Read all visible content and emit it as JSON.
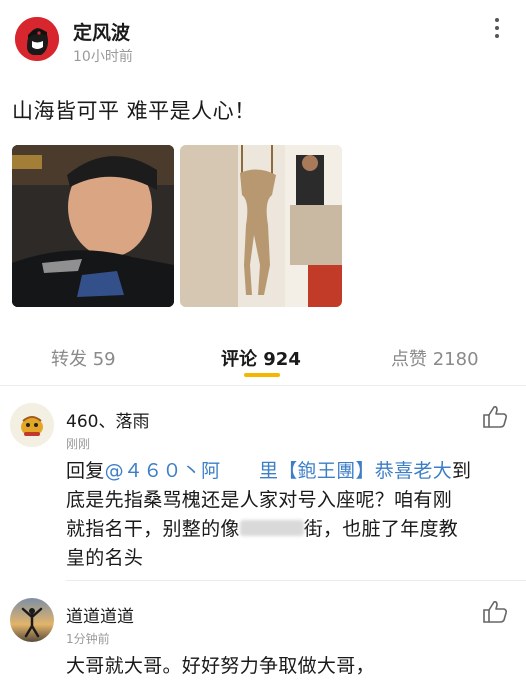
{
  "post": {
    "author": "定风波",
    "time": "10小时前",
    "text": "山海皆可平 难平是人心！",
    "images": [
      {
        "desc": "selfie-photo"
      },
      {
        "desc": "hanging-figure-photo"
      }
    ]
  },
  "tabs": {
    "repost_label": "转发 59",
    "comments_label": "评论",
    "comments_count": "924",
    "likes_label": "点赞 2180"
  },
  "comments": [
    {
      "name": "460、落雨",
      "time": "刚刚",
      "reply_prefix": "回复",
      "mention": "@４６０丶阿　　里【鉋王團】恭喜老大",
      "line1_end": "到",
      "line2": "底是先指桑骂槐还是人家对号入座呢？咱有刚",
      "line3": "就指名干，别整的像",
      "line3_after": "街，也脏了年度教",
      "line4": "皇的名头"
    },
    {
      "name": "道道道道",
      "time": "1分钟前",
      "text": "大哥就大哥。好好努力争取做大哥，"
    }
  ],
  "colors": {
    "accent": "#f7b500",
    "mention": "#3d7fc7",
    "muted": "#9a9a9a"
  }
}
